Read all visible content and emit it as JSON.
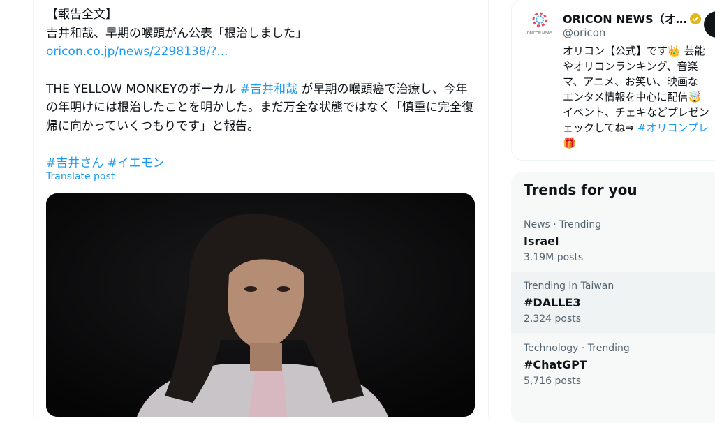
{
  "tweet": {
    "lines": [
      "【報告全文】",
      "吉井和哉、早期の喉頭がん公表「根治しました」"
    ],
    "link": "oricon.co.jp/news/2298138/?...",
    "body_pre": "THE YELLOW MONKEYのボーカル ",
    "body_hashtag": "#吉井和哉",
    "body_post": " が早期の喉頭癌で治療し、今年の年明けには根治したことを明かした。まだ万全な状態ではなく「慎重に完全復帰に向かっていくつもりです」と報告。",
    "hashtags": [
      "#吉井さん",
      "#イエモン"
    ],
    "translate_label": "Translate post"
  },
  "profile": {
    "name": "ORICON NEWS（オ…",
    "handle": "@oricon",
    "avatar_caption": "ORICON NEWS",
    "bio": "オリコン【公式】です👑 芸能\nやオリコンランキング、音楽\nマ、アニメ、お笑い、映画な\nエンタメ情報を中心に配信🤯\nイベント、チェキなどプレゼン\nェックしてね⇒",
    "bio_hashtag": "#オリコンプレ",
    "bio_end": "🎁"
  },
  "trends": {
    "title": "Trends for you",
    "items": [
      {
        "context": "News · Trending",
        "name": "Israel",
        "count": "3.19M posts"
      },
      {
        "context": "Trending in Taiwan",
        "name": "#DALLE3",
        "count": "2,324 posts"
      },
      {
        "context": "Technology · Trending",
        "name": "#ChatGPT",
        "count": "5,716 posts"
      }
    ]
  },
  "colors": {
    "accent": "#1d9bf0",
    "text": "#0f1419",
    "muted": "#536471",
    "trend_bg": "#f7f9f9"
  }
}
